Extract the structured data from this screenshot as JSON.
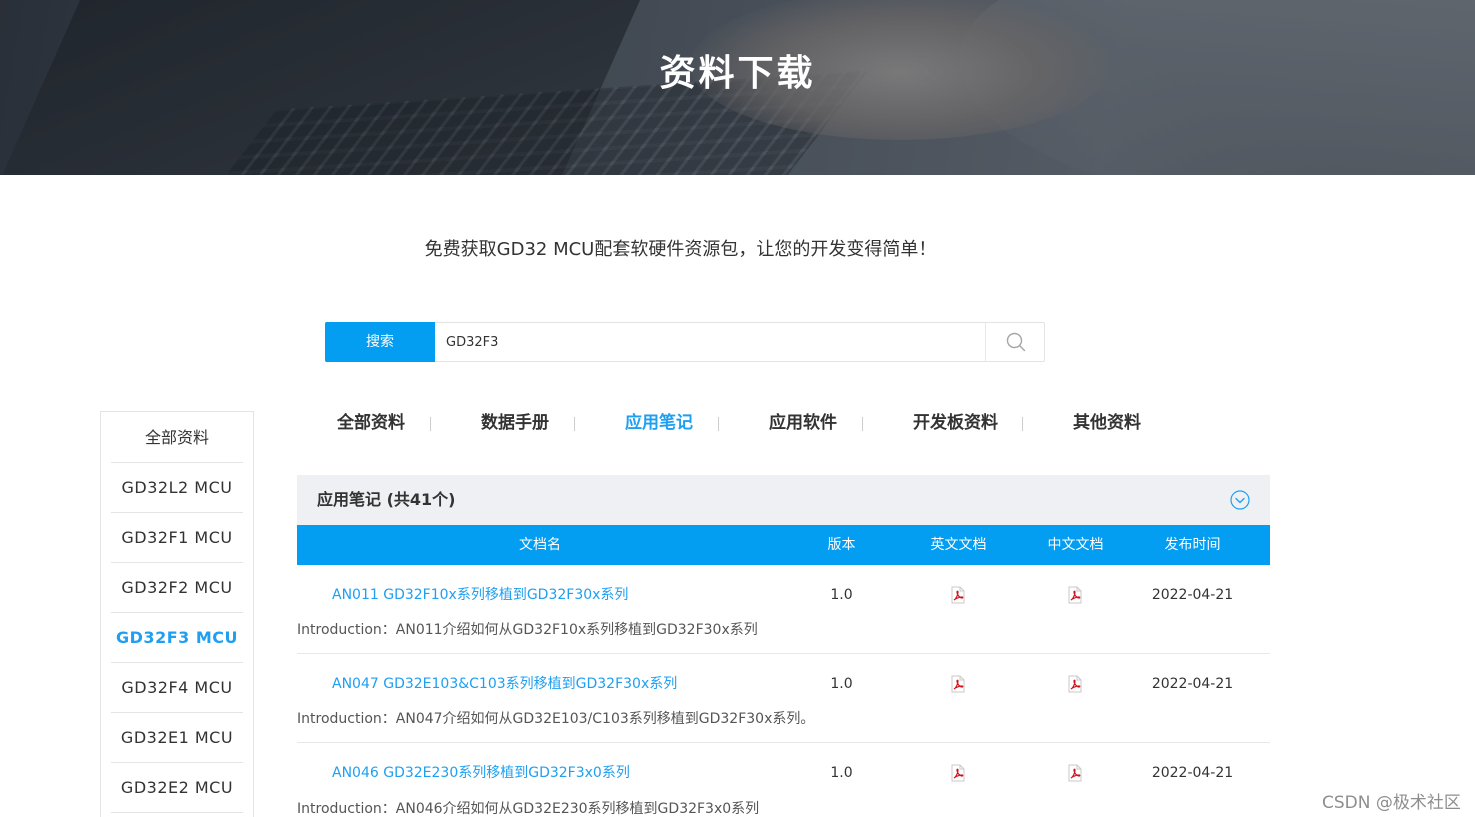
{
  "banner": {
    "title": "资料下载"
  },
  "subtitle": "免费获取GD32 MCU配套软硬件资源包，让您的开发变得简单！",
  "search": {
    "button_label": "搜索",
    "value": "GD32F3",
    "icon": "search-icon"
  },
  "sidebar": {
    "header": "全部资料",
    "items": [
      {
        "label": "GD32L2  MCU",
        "active": false
      },
      {
        "label": "GD32F1  MCU",
        "active": false
      },
      {
        "label": "GD32F2  MCU",
        "active": false
      },
      {
        "label": "GD32F3  MCU",
        "active": true
      },
      {
        "label": "GD32F4  MCU",
        "active": false
      },
      {
        "label": "GD32E1  MCU",
        "active": false
      },
      {
        "label": "GD32E2  MCU",
        "active": false
      }
    ]
  },
  "tabs": [
    {
      "label": "全部资料",
      "active": false
    },
    {
      "label": "数据手册",
      "active": false
    },
    {
      "label": "应用笔记",
      "active": true
    },
    {
      "label": "应用软件",
      "active": false
    },
    {
      "label": "开发板资料",
      "active": false
    },
    {
      "label": "其他资料",
      "active": false
    }
  ],
  "section": {
    "title": "应用笔记 (共41个)",
    "icon": "chevron-down-circle-icon"
  },
  "table": {
    "headers": [
      "文档名",
      "版本",
      "英文文档",
      "中文文档",
      "发布时间"
    ],
    "rows": [
      {
        "name": "AN011 GD32F10x系列移植到GD32F30x系列",
        "version": "1.0",
        "date": "2022-04-21",
        "intro": "Introduction：AN011介绍如何从GD32F10x系列移植到GD32F30x系列"
      },
      {
        "name": "AN047 GD32E103&C103系列移植到GD32F30x系列",
        "version": "1.0",
        "date": "2022-04-21",
        "intro": "Introduction：AN047介绍如何从GD32E103/C103系列移植到GD32F30x系列。"
      },
      {
        "name": "AN046 GD32E230系列移植到GD32F3x0系列",
        "version": "1.0",
        "date": "2022-04-21",
        "intro": "Introduction：AN046介绍如何从GD32E230系列移植到GD32F3x0系列"
      }
    ]
  },
  "watermark": "CSDN @极术社区",
  "colors": {
    "accent": "#039df2",
    "link": "#1e9ff2",
    "section_bg": "#eef0f3"
  }
}
